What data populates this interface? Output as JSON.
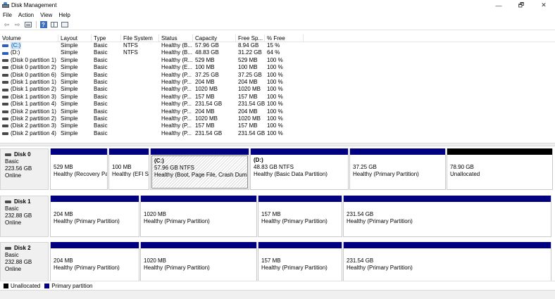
{
  "window": {
    "title": "Disk Management",
    "controls": [
      "—",
      "🗗",
      "✕"
    ]
  },
  "menu": [
    "File",
    "Action",
    "View",
    "Help"
  ],
  "toolbar": {
    "back": "⇦",
    "forward": "⇨"
  },
  "volume_table": {
    "columns": [
      "Volume",
      "Layout",
      "Type",
      "File System",
      "Status",
      "Capacity",
      "Free Sp...",
      "% Free"
    ],
    "rows": [
      [
        "(C:)",
        "Simple",
        "Basic",
        "NTFS",
        "Healthy (B...",
        "57.96 GB",
        "8.94 GB",
        "15 %"
      ],
      [
        "(D:)",
        "Simple",
        "Basic",
        "NTFS",
        "Healthy (B...",
        "48.83 GB",
        "31.22 GB",
        "64 %"
      ],
      [
        "(Disk 0 partition 1)",
        "Simple",
        "Basic",
        "",
        "Healthy (R...",
        "529 MB",
        "529 MB",
        "100 %"
      ],
      [
        "(Disk 0 partition 2)",
        "Simple",
        "Basic",
        "",
        "Healthy (E...",
        "100 MB",
        "100 MB",
        "100 %"
      ],
      [
        "(Disk 0 partition 6)",
        "Simple",
        "Basic",
        "",
        "Healthy (P...",
        "37.25 GB",
        "37.25 GB",
        "100 %"
      ],
      [
        "(Disk 1 partition 1)",
        "Simple",
        "Basic",
        "",
        "Healthy (P...",
        "204 MB",
        "204 MB",
        "100 %"
      ],
      [
        "(Disk 1 partition 2)",
        "Simple",
        "Basic",
        "",
        "Healthy (P...",
        "1020 MB",
        "1020 MB",
        "100 %"
      ],
      [
        "(Disk 1 partition 3)",
        "Simple",
        "Basic",
        "",
        "Healthy (P...",
        "157 MB",
        "157 MB",
        "100 %"
      ],
      [
        "(Disk 1 partition 4)",
        "Simple",
        "Basic",
        "",
        "Healthy (P...",
        "231.54 GB",
        "231.54 GB",
        "100 %"
      ],
      [
        "(Disk 2 partition 1)",
        "Simple",
        "Basic",
        "",
        "Healthy (P...",
        "204 MB",
        "204 MB",
        "100 %"
      ],
      [
        "(Disk 2 partition 2)",
        "Simple",
        "Basic",
        "",
        "Healthy (P...",
        "1020 MB",
        "1020 MB",
        "100 %"
      ],
      [
        "(Disk 2 partition 3)",
        "Simple",
        "Basic",
        "",
        "Healthy (P...",
        "157 MB",
        "157 MB",
        "100 %"
      ],
      [
        "(Disk 2 partition 4)",
        "Simple",
        "Basic",
        "",
        "Healthy (P...",
        "231.54 GB",
        "231.54 GB",
        "100 %"
      ]
    ]
  },
  "disks": [
    {
      "name": "Disk 0",
      "type": "Basic",
      "size": "223.56 GB",
      "status": "Online",
      "partitions": [
        {
          "label": "",
          "size": "529 MB",
          "status": "Healthy (Recovery Partition)",
          "kind": "primary",
          "selected": false
        },
        {
          "label": "",
          "size": "100 MB",
          "status": "Healthy (EFI System Partition)",
          "kind": "primary",
          "selected": false
        },
        {
          "label": "(C:)",
          "size": "57.96 GB NTFS",
          "status": "Healthy (Boot, Page File, Crash Dump, Basic Data Partition)",
          "kind": "primary",
          "selected": true
        },
        {
          "label": "(D:)",
          "size": "48.83 GB NTFS",
          "status": "Healthy (Basic Data Partition)",
          "kind": "primary",
          "selected": false
        },
        {
          "label": "",
          "size": "37.25 GB",
          "status": "Healthy (Primary Partition)",
          "kind": "primary",
          "selected": false
        },
        {
          "label": "",
          "size": "78.90 GB",
          "status": "Unallocated",
          "kind": "unallocated",
          "selected": false
        }
      ]
    },
    {
      "name": "Disk 1",
      "type": "Basic",
      "size": "232.88 GB",
      "status": "Online",
      "partitions": [
        {
          "label": "",
          "size": "204 MB",
          "status": "Healthy (Primary Partition)",
          "kind": "primary",
          "selected": false
        },
        {
          "label": "",
          "size": "1020 MB",
          "status": "Healthy (Primary Partition)",
          "kind": "primary",
          "selected": false
        },
        {
          "label": "",
          "size": "157 MB",
          "status": "Healthy (Primary Partition)",
          "kind": "primary",
          "selected": false
        },
        {
          "label": "",
          "size": "231.54 GB",
          "status": "Healthy (Primary Partition)",
          "kind": "primary",
          "selected": false
        }
      ]
    },
    {
      "name": "Disk 2",
      "type": "Basic",
      "size": "232.88 GB",
      "status": "Online",
      "partitions": [
        {
          "label": "",
          "size": "204 MB",
          "status": "Healthy (Primary Partition)",
          "kind": "primary",
          "selected": false
        },
        {
          "label": "",
          "size": "1020 MB",
          "status": "Healthy (Primary Partition)",
          "kind": "primary",
          "selected": false
        },
        {
          "label": "",
          "size": "157 MB",
          "status": "Healthy (Primary Partition)",
          "kind": "primary",
          "selected": false
        },
        {
          "label": "",
          "size": "231.54 GB",
          "status": "Healthy (Primary Partition)",
          "kind": "primary",
          "selected": false
        }
      ]
    }
  ],
  "legend": [
    {
      "label": "Unallocated",
      "color": "#000000"
    },
    {
      "label": "Primary partition",
      "color": "#000080"
    }
  ]
}
